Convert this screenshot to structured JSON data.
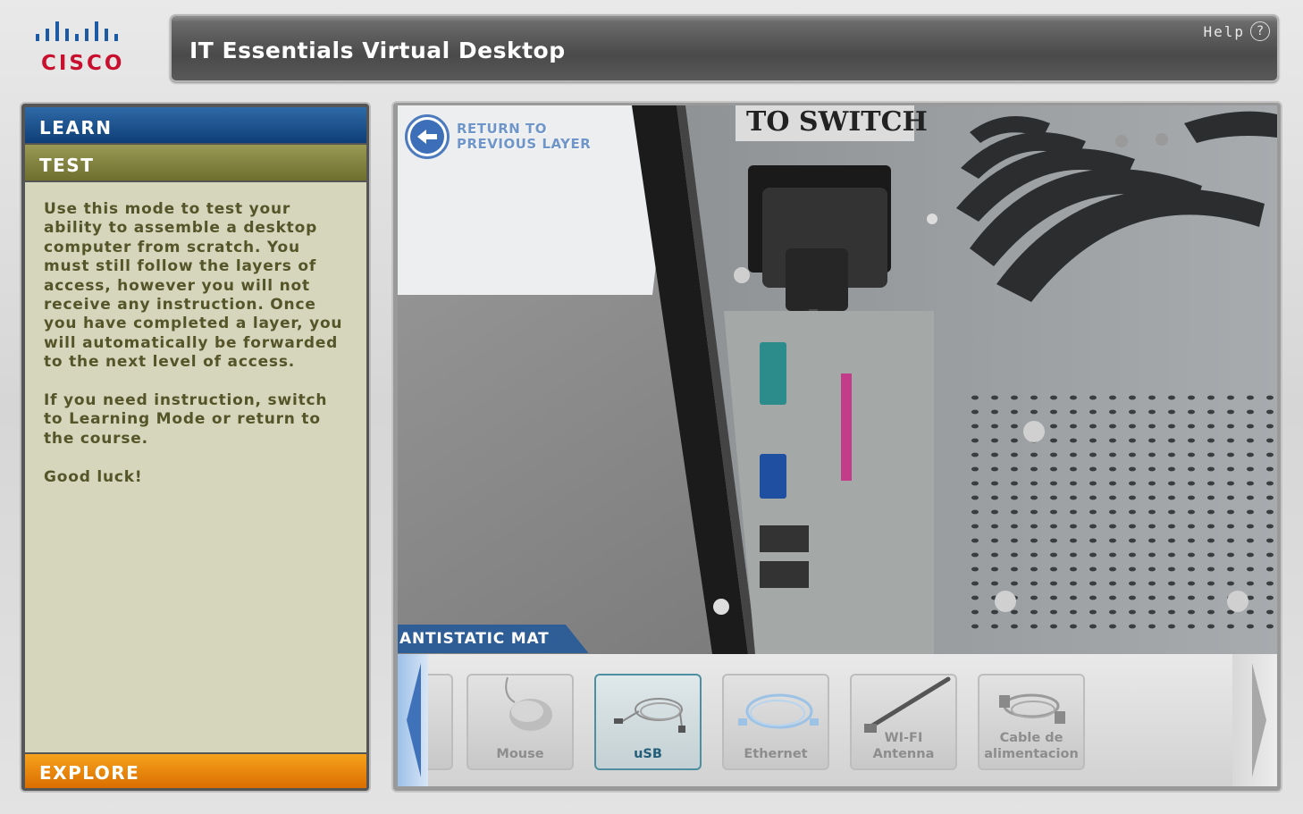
{
  "brand": {
    "logo_text": "CISCO",
    "logo_color": "#c8102e"
  },
  "header": {
    "title": "IT Essentials Virtual Desktop",
    "help_label": "Help",
    "help_icon_glyph": "?"
  },
  "sidebar": {
    "learn_label": "LEARN",
    "test_label": "TEST",
    "explore_label": "EXPLORE",
    "paragraphs": [
      "Use this mode to test your ability to assemble a desktop computer from scratch. You must still follow the layers of access, however you will not receive any instruction. Once you have completed a layer, you will automatically be forwarded to the next level of access.",
      "If you need instruction, switch to Learning Mode or return to the course.",
      "Good luck!"
    ]
  },
  "scene": {
    "return_line1": "RETURN TO",
    "return_line2": "PREVIOUS LAYER",
    "psu_label": "TO SWITCH"
  },
  "tray": {
    "tab_label": "ANTISTATIC MAT",
    "items": [
      {
        "label": "Mouse",
        "icon": "mouse-icon",
        "selected": false
      },
      {
        "label": "uSB",
        "icon": "usb-cable-icon",
        "selected": true
      },
      {
        "label": "Ethernet",
        "icon": "ethernet-cable-icon",
        "selected": false
      },
      {
        "label": "WI-FI Antenna",
        "icon": "antenna-icon",
        "selected": false
      },
      {
        "label": "Cable de alimentacion",
        "icon": "power-cable-icon",
        "selected": false
      }
    ]
  },
  "colors": {
    "learn": "#0f3e76",
    "test": "#6e6e2e",
    "explore": "#e07800",
    "panel_bg": "#d6d6bd"
  }
}
